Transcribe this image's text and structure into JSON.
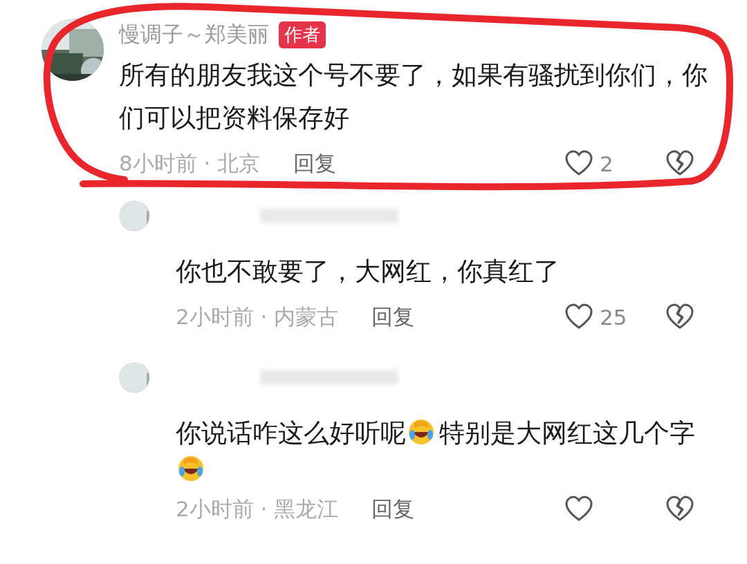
{
  "comments": [
    {
      "user": "慢调子～郑美丽",
      "badge": "作者",
      "avatar": {
        "kind": "picture"
      },
      "segments": [
        {
          "kind": "text",
          "text": "所有的朋友我这个号不要了，如果有骚扰到你们，你们可以把资料保存好"
        }
      ],
      "time": "8小时前 · 北京",
      "reply": "回复",
      "likes": "2",
      "replies": [
        {
          "name_blurred": true,
          "avatar": {
            "kind": "picture"
          },
          "segments": [
            {
              "kind": "text",
              "text": "你也不敢要了，大网红，你真红了"
            }
          ],
          "time": "2小时前 · 内蒙古",
          "reply": "回复",
          "likes": "25"
        },
        {
          "name_blurred": true,
          "avatar": {
            "kind": "picture"
          },
          "segments": [
            {
              "kind": "text",
              "text": "你说话咋这么好听呢"
            },
            {
              "kind": "emoji"
            },
            {
              "kind": "text",
              "text": "特别是大网红这几个字"
            },
            {
              "kind": "emoji"
            }
          ],
          "time": "2小时前 · 黑龙江",
          "reply": "回复"
        }
      ]
    }
  ],
  "annotation": {
    "kind": "loop",
    "color": "#e8262c"
  }
}
